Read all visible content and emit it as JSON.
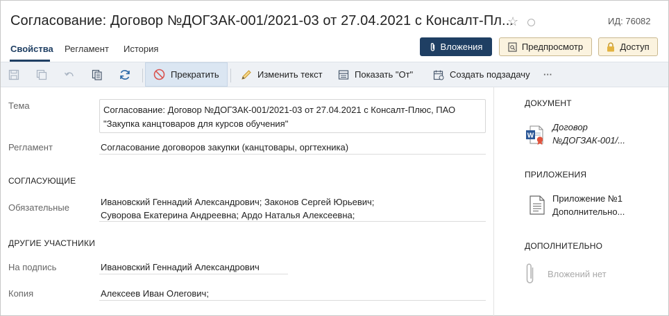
{
  "header": {
    "title": "Согласование: Договор №ДОГЗАК-001/2021-03 от 27.04.2021 с Консалт-Пл...",
    "doc_id": "ИД: 76082"
  },
  "tabs": [
    {
      "label": "Свойства",
      "active": true
    },
    {
      "label": "Регламент",
      "active": false
    },
    {
      "label": "История",
      "active": false
    }
  ],
  "actions": {
    "attachments": "Вложения",
    "preview": "Предпросмотр",
    "access": "Доступ"
  },
  "toolbar": {
    "stop": "Прекратить",
    "edit_text": "Изменить текст",
    "show_from": "Показать \"От\"",
    "create_subtask": "Создать подзадачу",
    "more": "···"
  },
  "form": {
    "tema_label": "Тема",
    "tema_line1": "Согласование: Договор №ДОГЗАК-001/2021-03 от 27.04.2021 с Консалт-Плюс, ПАО",
    "tema_line2": "\"Закупка канцтоваров для курсов обучения\"",
    "reglament_label": "Регламент",
    "reglament_value": "Согласование договоров закупки (канцтовары, оргтехника)",
    "approvers_section": "Согласующие",
    "mandatory_label": "Обязательные",
    "mandatory_line1": "Ивановский Геннадий Александрович;  Законов Сергей Юрьевич;",
    "mandatory_line2": "Суворова Екатерина Андреевна;  Ардо Наталья Алексеевна;",
    "others_section": "Другие участники",
    "signer_label": "На подпись",
    "signer_value": "Ивановский Геннадий Александрович",
    "copy_label": "Копия",
    "copy_value": "Алексеев Иван Олегович;"
  },
  "sidebar": {
    "document_section": "Документ",
    "document_line1": "Договор",
    "document_line2": "№ДОГЗАК-001/...",
    "appendix_section": "Приложения",
    "appendix_line1": "Приложение №1",
    "appendix_line2": "Дополнительно...",
    "extra_section": "Дополнительно",
    "no_attachments": "Вложений нет"
  },
  "colors": {
    "primary": "#1f3f63",
    "light_button": "#fbf3df",
    "toolbar_bg": "#eef1f5",
    "stop_red": "#d9534f",
    "word_blue": "#2b5797"
  },
  "icons": {
    "favorite": "star-icon",
    "status": "circle-icon",
    "attachments": "paperclip-icon",
    "preview": "preview-icon",
    "access": "lock-icon",
    "stop": "stop-icon",
    "edit": "pencil-icon",
    "show_from": "list-icon",
    "subtask": "calendar-icon",
    "refresh": "refresh-icon"
  }
}
